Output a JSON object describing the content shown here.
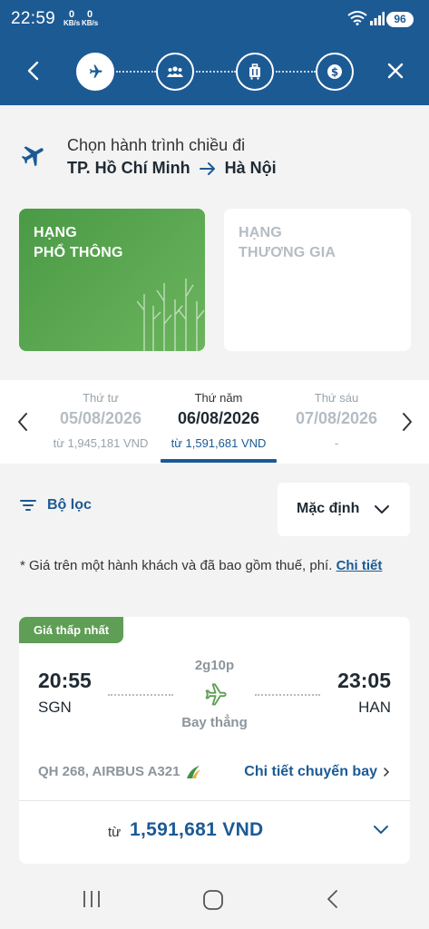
{
  "status_bar": {
    "time": "22:59",
    "speed1_value": "0",
    "speed1_unit": "KB/s",
    "speed2_value": "0",
    "speed2_unit": "KB/s",
    "battery": "96"
  },
  "header": {
    "back_icon": "chevron-left-icon",
    "close_icon": "close-icon",
    "steps": [
      "plane-icon",
      "passengers-icon",
      "luggage-icon",
      "payment-icon"
    ],
    "active_step": 0,
    "bg_color": "#1c5a94"
  },
  "route": {
    "subtitle": "Chọn hành trình chiều đi",
    "origin": "TP. Hồ Chí Minh",
    "destination": "Hà Nội"
  },
  "cabin_classes": [
    {
      "line1": "HẠNG",
      "line2": "PHỔ THÔNG",
      "selected": true,
      "color": "#5aa54f"
    },
    {
      "line1": "HẠNG",
      "line2": "THƯƠNG GIA",
      "selected": false
    }
  ],
  "dates": [
    {
      "dow": "Thứ tư",
      "date": "05/08/2026",
      "price": "từ 1,945,181 VND"
    },
    {
      "dow": "Thứ năm",
      "date": "06/08/2026",
      "price": "từ 1,591,681 VND"
    },
    {
      "dow": "Thứ sáu",
      "date": "07/08/2026",
      "price": "-"
    }
  ],
  "selected_date_index": 1,
  "filter": {
    "label": "Bộ lọc",
    "sort_label": "Mặc định"
  },
  "note": {
    "text": "* Giá trên một hành khách và đã bao gồm thuế, phí. ",
    "link": "Chi tiết"
  },
  "flight": {
    "badge": "Giá thấp nhất",
    "dep_time": "20:55",
    "dep_code": "SGN",
    "arr_time": "23:05",
    "arr_code": "HAN",
    "duration": "2g10p",
    "stops": "Bay thẳng",
    "flight_no": "QH 268, AIRBUS A321",
    "detail_link": "Chi tiết chuyến bay",
    "price_prefix": "từ",
    "price": "1,591,681 VND"
  }
}
